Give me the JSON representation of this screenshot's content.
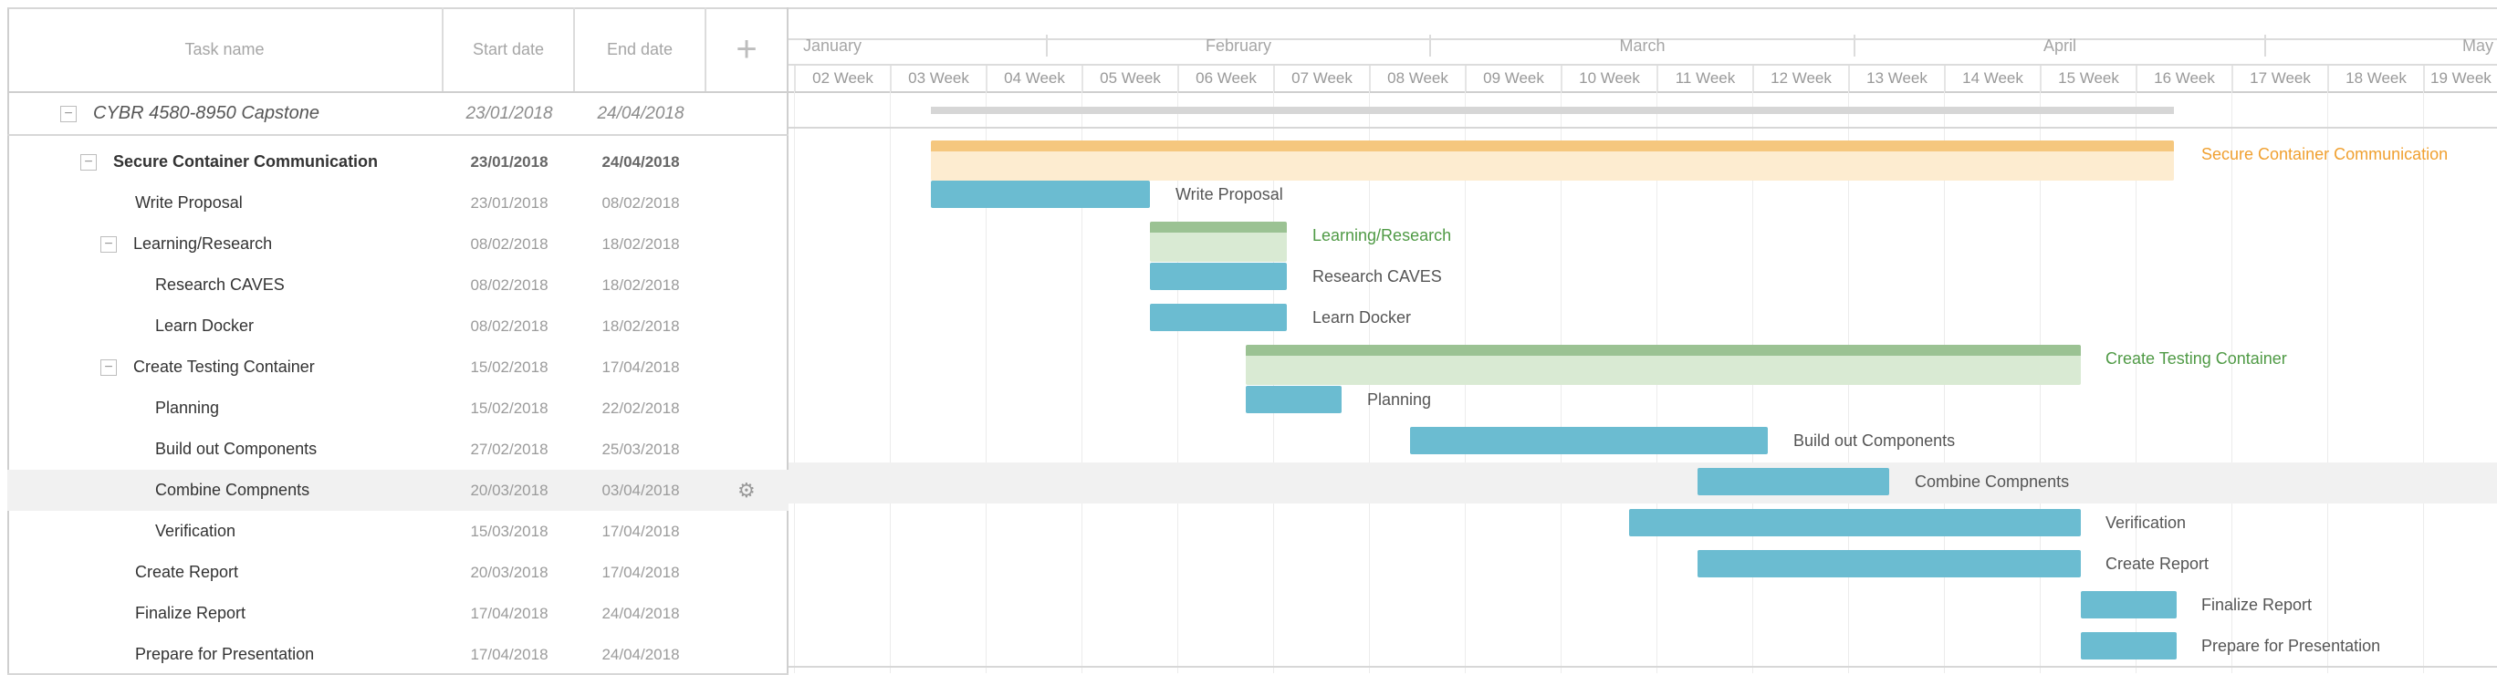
{
  "headers": {
    "task_name": "Task name",
    "start_date": "Start date",
    "end_date": "End date",
    "add_icon": "plus-icon"
  },
  "timeline": {
    "months": [
      "January",
      "February",
      "March",
      "April",
      "May"
    ],
    "weeks": [
      "02 Week",
      "03 Week",
      "04 Week",
      "05 Week",
      "06 Week",
      "07 Week",
      "08 Week",
      "09 Week",
      "10 Week",
      "11 Week",
      "12 Week",
      "13 Week",
      "14 Week",
      "15 Week",
      "16 Week",
      "17 Week",
      "18 Week",
      "19 Week"
    ]
  },
  "tasks": [
    {
      "name": "CYBR 4580-8950 Capstone",
      "start": "23/01/2018",
      "end": "24/04/2018",
      "type": "project"
    },
    {
      "name": "Secure Container Communication",
      "start": "23/01/2018",
      "end": "24/04/2018",
      "type": "group",
      "label": "Secure Container Communication"
    },
    {
      "name": "Write Proposal",
      "start": "23/01/2018",
      "end": "08/02/2018",
      "type": "task",
      "label": "Write Proposal"
    },
    {
      "name": "Learning/Research",
      "start": "08/02/2018",
      "end": "18/02/2018",
      "type": "subgroup",
      "label": "Learning/Research"
    },
    {
      "name": "Research CAVES",
      "start": "08/02/2018",
      "end": "18/02/2018",
      "type": "task",
      "label": "Research CAVES"
    },
    {
      "name": "Learn Docker",
      "start": "08/02/2018",
      "end": "18/02/2018",
      "type": "task",
      "label": "Learn Docker"
    },
    {
      "name": "Create Testing Container",
      "start": "15/02/2018",
      "end": "17/04/2018",
      "type": "subgroup",
      "label": "Create Testing Container"
    },
    {
      "name": "Planning",
      "start": "15/02/2018",
      "end": "22/02/2018",
      "type": "task",
      "label": "Planning"
    },
    {
      "name": "Build out Components",
      "start": "27/02/2018",
      "end": "25/03/2018",
      "type": "task",
      "label": "Build out Components"
    },
    {
      "name": "Combine Compnents",
      "start": "20/03/2018",
      "end": "03/04/2018",
      "type": "task",
      "label": "Combine Compnents"
    },
    {
      "name": "Verification",
      "start": "15/03/2018",
      "end": "17/04/2018",
      "type": "task",
      "label": "Verification"
    },
    {
      "name": "Create Report",
      "start": "20/03/2018",
      "end": "17/04/2018",
      "type": "task",
      "label": "Create Report"
    },
    {
      "name": "Finalize Report",
      "start": "17/04/2018",
      "end": "24/04/2018",
      "type": "task",
      "label": "Finalize Report"
    },
    {
      "name": "Prepare for Presentation",
      "start": "17/04/2018",
      "end": "24/04/2018",
      "type": "task",
      "label": "Prepare for Presentation"
    }
  ],
  "colors": {
    "task_bar": "#6bbcd1",
    "group_bar": "#f5c77e",
    "group_label": "#f0a030",
    "subgroup_bar": "#9bc293",
    "subgroup_label": "#4f9a45"
  },
  "icons": {
    "collapse": "minus-box-icon",
    "settings": "gear-icon"
  }
}
